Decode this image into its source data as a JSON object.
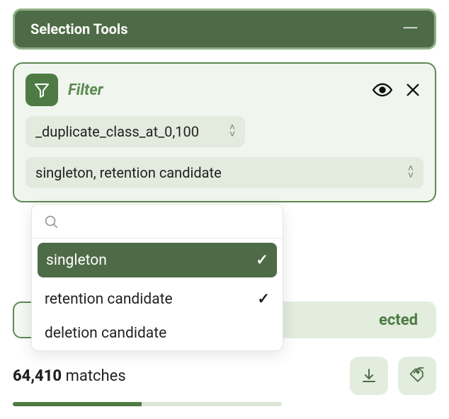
{
  "header": {
    "title": "Selection Tools"
  },
  "filter": {
    "label": "Filter",
    "field_value": "_duplicate_class_at_0,100",
    "values_value": "singleton, retention candidate",
    "dropdown": {
      "search_value": "",
      "options": [
        {
          "label": "singleton",
          "selected": true,
          "highlighted": true
        },
        {
          "label": "retention candidate",
          "selected": true,
          "highlighted": false
        },
        {
          "label": "deletion candidate",
          "selected": false,
          "highlighted": false
        }
      ]
    }
  },
  "actions": {
    "selected_label": "ected"
  },
  "matches": {
    "count": "64,410",
    "label": "matches",
    "progress_pct": 48
  },
  "icons": {
    "funnel": "funnel-icon",
    "eye": "eye-icon",
    "close": "close-icon",
    "download": "download-icon",
    "tags": "tags-icon",
    "search": "search-icon",
    "updown": "chevron-updown-icon"
  }
}
